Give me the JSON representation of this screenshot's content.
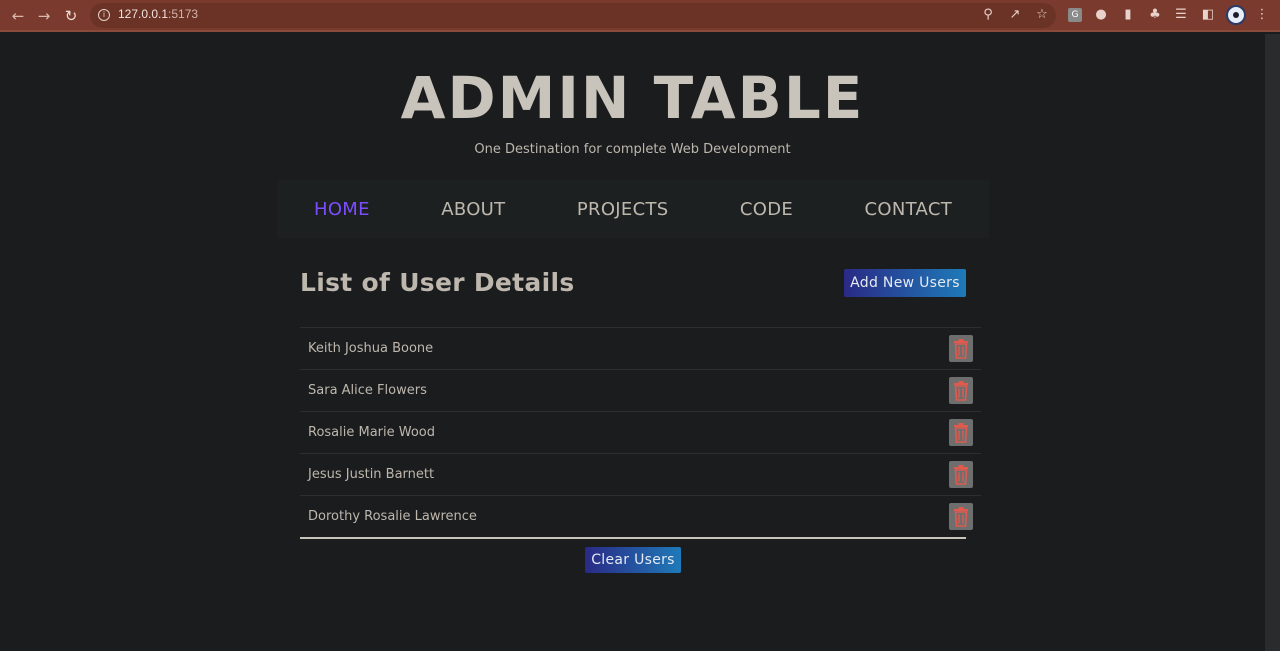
{
  "browser": {
    "url_host": "127.0.0.1",
    "url_port": ":5173",
    "profile_extension_letter": "G"
  },
  "header": {
    "title": "ADMIN TABLE",
    "subtitle": "One Destination for complete Web Development"
  },
  "nav": {
    "items": [
      {
        "label": "HOME",
        "active": true
      },
      {
        "label": "ABOUT"
      },
      {
        "label": "PROJECTS"
      },
      {
        "label": "CODE"
      },
      {
        "label": "CONTACT"
      }
    ]
  },
  "main": {
    "heading": "List of User Details",
    "add_button": "Add New Users",
    "users": [
      {
        "name": "Keith Joshua Boone"
      },
      {
        "name": "Sara Alice Flowers"
      },
      {
        "name": "Rosalie Marie Wood"
      },
      {
        "name": "Jesus Justin Barnett"
      },
      {
        "name": "Dorothy Rosalie Lawrence"
      }
    ],
    "clear_button": "Clear Users"
  },
  "colors": {
    "background": "#1b1c1e",
    "nav_active": "#7c4dff",
    "delete_icon": "#e05a4e",
    "button_gradient_start": "#2a2a86",
    "button_gradient_end": "#1e7ab8"
  },
  "icons": {
    "back": "arrow-left-icon",
    "forward": "arrow-right-icon",
    "reload": "reload-icon",
    "info": "info-icon",
    "delete": "trash-icon"
  }
}
